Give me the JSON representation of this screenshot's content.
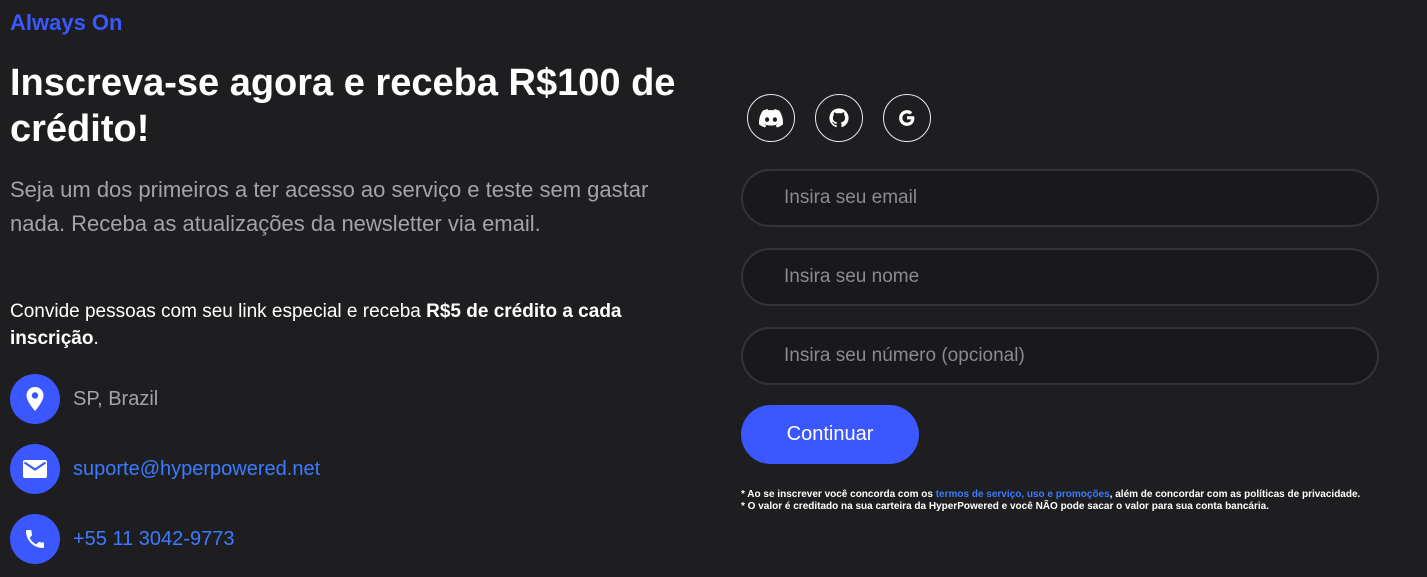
{
  "brand": "Always On",
  "hero": {
    "headline": "Inscreva-se agora e receba R$100 de crédito!",
    "subtitle": "Seja um dos primeiros a ter acesso ao serviço e teste sem gastar nada. Receba as atualizações da newsletter via email."
  },
  "invite": {
    "text_start": "Convide pessoas com seu link especial e receba ",
    "text_bold": "R$5 de crédito a cada inscrição",
    "text_end": "."
  },
  "contacts": {
    "location": {
      "icon": "location-pin-icon",
      "text": "SP, Brazil"
    },
    "email": {
      "icon": "mail-icon",
      "text": "suporte@hyperpowered.net"
    },
    "phone": {
      "icon": "phone-icon",
      "text": "+55 11 3042-9773"
    }
  },
  "social": [
    {
      "name": "Discord",
      "icon": "discord-icon"
    },
    {
      "name": "GitHub",
      "icon": "github-icon"
    },
    {
      "name": "Google",
      "icon": "google-icon"
    }
  ],
  "form": {
    "email_placeholder": "Insira seu email",
    "name_placeholder": "Insira seu nome",
    "phone_placeholder": "Insira seu número (opcional)",
    "email_value": "",
    "name_value": "",
    "phone_value": "",
    "submit_label": "Continuar"
  },
  "notes": {
    "line1_start": "* Ao se inscrever você concorda com os ",
    "line1_link": "termos de serviço, uso e promoções",
    "line1_end": ", além de concordar com as políticas de privacidade.",
    "line2": "* O valor é creditado na sua carteira da HyperPowered e você NÃO pode sacar o valor para sua conta bancária."
  },
  "colors": {
    "background": "#1e1e21",
    "accent": "#3b57ff",
    "link": "#3b7bff",
    "muted_text": "#a3a3a8",
    "field_border": "#333338"
  }
}
